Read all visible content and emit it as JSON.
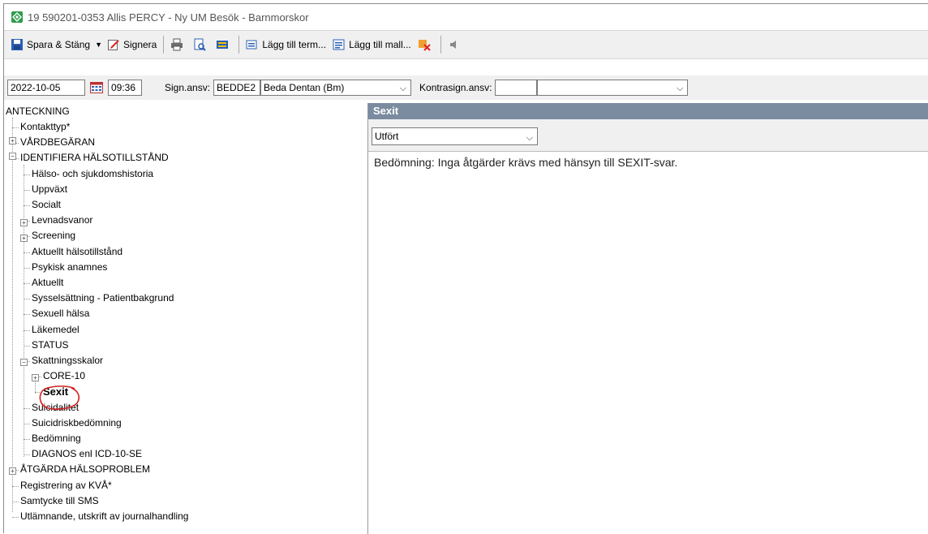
{
  "window": {
    "title": "19 590201-0353 Allis PERCY - Ny UM Besök - Barnmorskor"
  },
  "toolbar": {
    "save_close": "Spara & Stäng",
    "sign": "Signera",
    "add_term": "Lägg till term...",
    "add_template": "Lägg till mall..."
  },
  "header": {
    "date": "2022-10-05",
    "time": "09:36",
    "sign_label": "Sign.ansv:",
    "sign_code": "BEDDE2",
    "sign_name": "Beda Dentan (Bm)",
    "countersign_label": "Kontrasign.ansv:",
    "countersign_code": "",
    "countersign_name": ""
  },
  "tree": {
    "root": "ANTECKNING",
    "items": [
      "Kontakttyp*",
      "VÅRDBEGÄRAN",
      "IDENTIFIERA HÄLSOTILLSTÅND",
      "Hälso- och sjukdomshistoria",
      "Uppväxt",
      "Socialt",
      "Levnadsvanor",
      "Screening",
      "Aktuellt hälsotillstånd",
      "Psykisk anamnes",
      "Aktuellt",
      "Sysselsättning - Patientbakgrund",
      "Sexuell hälsa",
      "Läkemedel",
      "STATUS",
      "Skattningsskalor",
      "CORE-10",
      "Sexit",
      "Suicidalitet",
      "Suicidriskbedömning",
      "Bedömning",
      "DIAGNOS enl ICD-10-SE",
      "ÅTGÄRDA HÄLSOPROBLEM",
      "Registrering av KVÅ*",
      "Samtycke till SMS",
      "Utlämnande, utskrift av journalhandling"
    ]
  },
  "section": {
    "title": "Sexit",
    "status_selected": "Utfört",
    "text": "Bedömning: Inga åtgärder krävs med hänsyn till SEXIT-svar."
  },
  "colors": {
    "section_header": "#7b8ba0",
    "toolbar_bg": "#f0f0f0",
    "annotation_circle": "#d42020"
  }
}
